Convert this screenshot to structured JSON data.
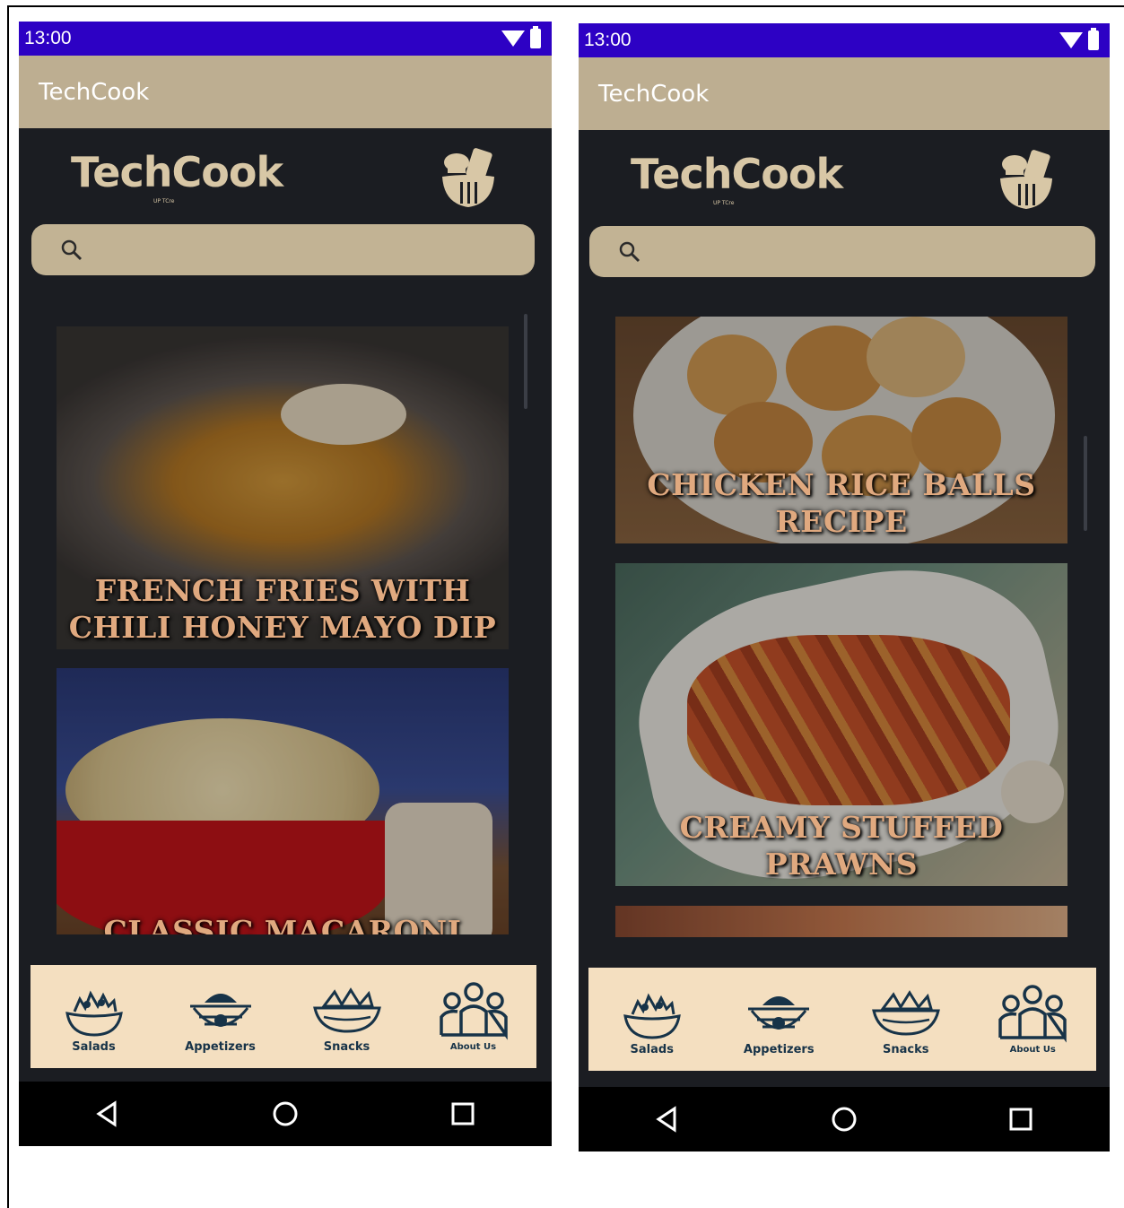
{
  "status": {
    "time": "13:00"
  },
  "app_bar": {
    "title": "TechCook"
  },
  "brand": {
    "name": "TechCook",
    "sub": "UP TCre"
  },
  "search": {
    "placeholder": ""
  },
  "screen1": {
    "recipes": [
      {
        "title": "FRENCH FRIES WITH CHILI HONEY MAYO DIP"
      },
      {
        "title": "CLASSIC MACARONI"
      }
    ]
  },
  "screen2": {
    "recipes": [
      {
        "title": "CHICKEN RICE BALLS RECIPE"
      },
      {
        "title": "CREAMY STUFFED PRAWNS"
      }
    ]
  },
  "nav": {
    "items": [
      {
        "label": "Salads",
        "icon": "salad-bowl-icon"
      },
      {
        "label": "Appetizers",
        "icon": "appetizer-bowl-icon"
      },
      {
        "label": "Snacks",
        "icon": "snacks-bowl-icon"
      },
      {
        "label": "About Us",
        "icon": "people-icon"
      }
    ]
  },
  "colors": {
    "status_bar": "#2d01c4",
    "app_bar": "#bdae91",
    "background": "#1b1d22",
    "search": "#c2b394",
    "bottom_nav": "#f4dfc0",
    "title_text": "#e0a97f",
    "nav_icon": "#173348"
  }
}
